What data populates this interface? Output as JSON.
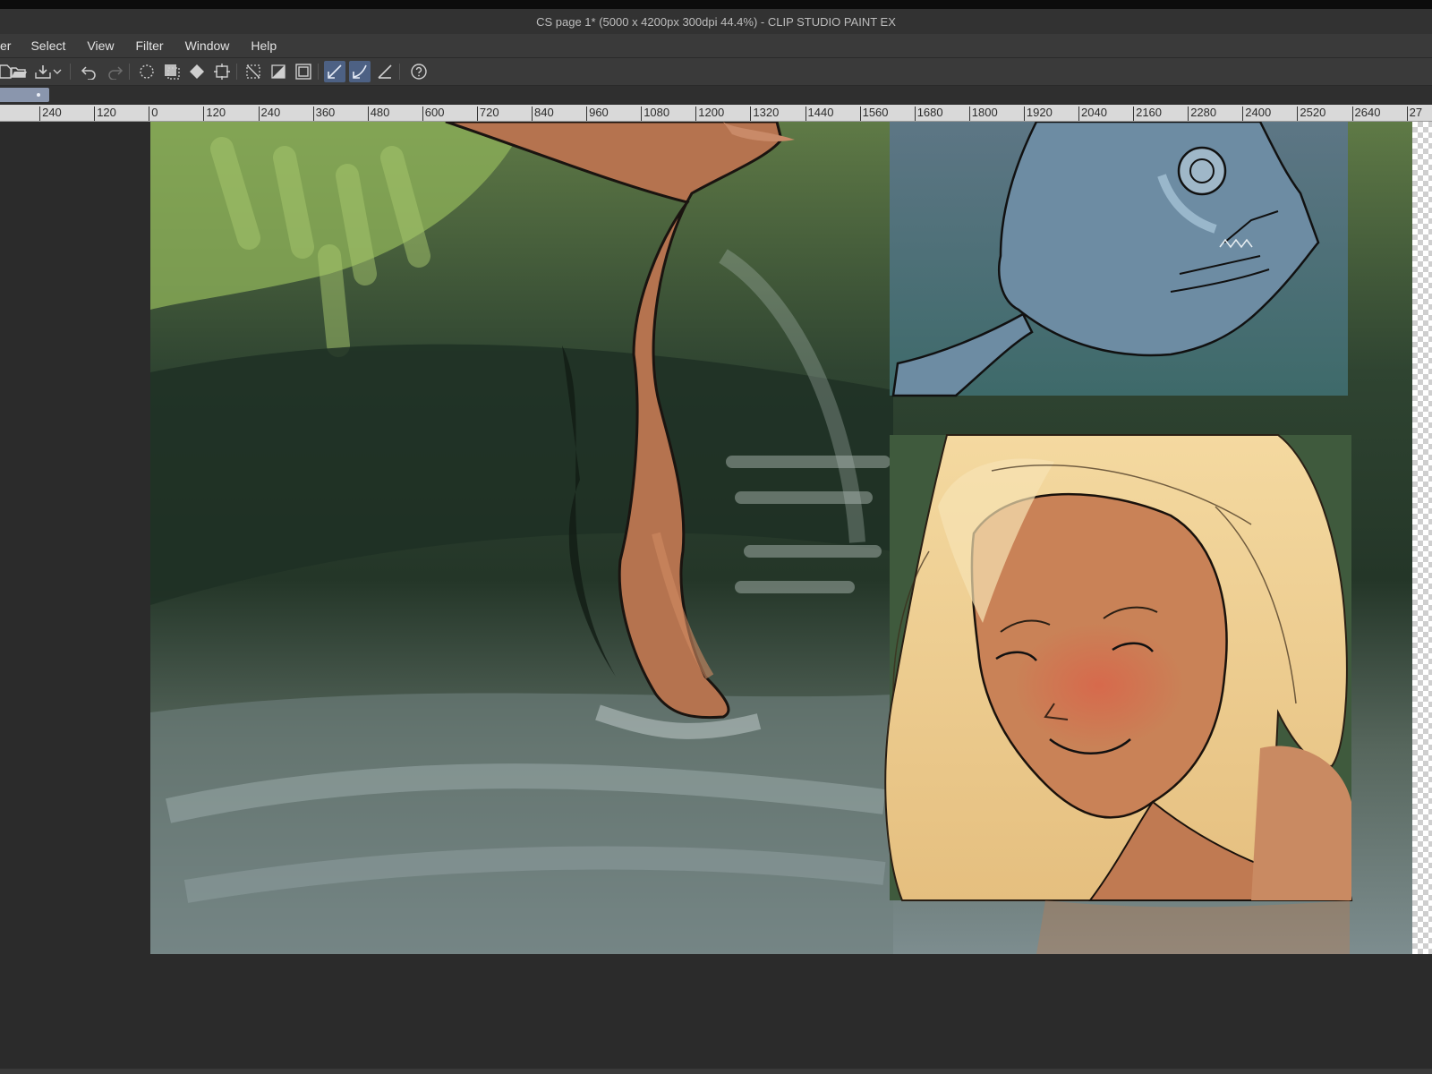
{
  "app": {
    "title": "CS page 1* (5000 x 4200px 300dpi 44.4%)  - CLIP STUDIO PAINT EX"
  },
  "menu": {
    "items": [
      "er",
      "Select",
      "View",
      "Filter",
      "Window",
      "Help"
    ]
  },
  "toolbar": {
    "buttons": [
      {
        "icon": "new-file-icon"
      },
      {
        "icon": "open-folder-icon"
      },
      {
        "icon": "save-icon"
      },
      {
        "icon": "dropdown-arrow-icon"
      },
      {
        "icon": "undo-icon"
      },
      {
        "icon": "redo-icon"
      },
      {
        "icon": "clear-icon"
      },
      {
        "icon": "clear-outside-selection-icon"
      },
      {
        "icon": "fill-icon"
      },
      {
        "icon": "transform-icon"
      },
      {
        "icon": "deselect-icon"
      },
      {
        "icon": "invert-selection-icon"
      },
      {
        "icon": "canvas-frame-icon"
      },
      {
        "icon": "snap-to-ruler-icon",
        "active": true
      },
      {
        "icon": "snap-to-special-ruler-icon",
        "active": true
      },
      {
        "icon": "snap-to-grid-icon"
      },
      {
        "icon": "help-icon"
      }
    ]
  },
  "ruler": {
    "ticks": [
      "60",
      "240",
      "120",
      "0",
      "120",
      "240",
      "360",
      "480",
      "600",
      "720",
      "840",
      "960",
      "1080",
      "1200",
      "1320",
      "1440",
      "1560",
      "1680",
      "1800",
      "1920",
      "2040",
      "2160",
      "2280",
      "2400",
      "2520",
      "2640",
      "27"
    ]
  },
  "canvas": {
    "document": "CS page 1*",
    "zoom": "44.4%"
  },
  "colors": {
    "accent_active": "#4d6184",
    "workspace": "#2b2b2b",
    "chrome": "#3a3a3a"
  }
}
